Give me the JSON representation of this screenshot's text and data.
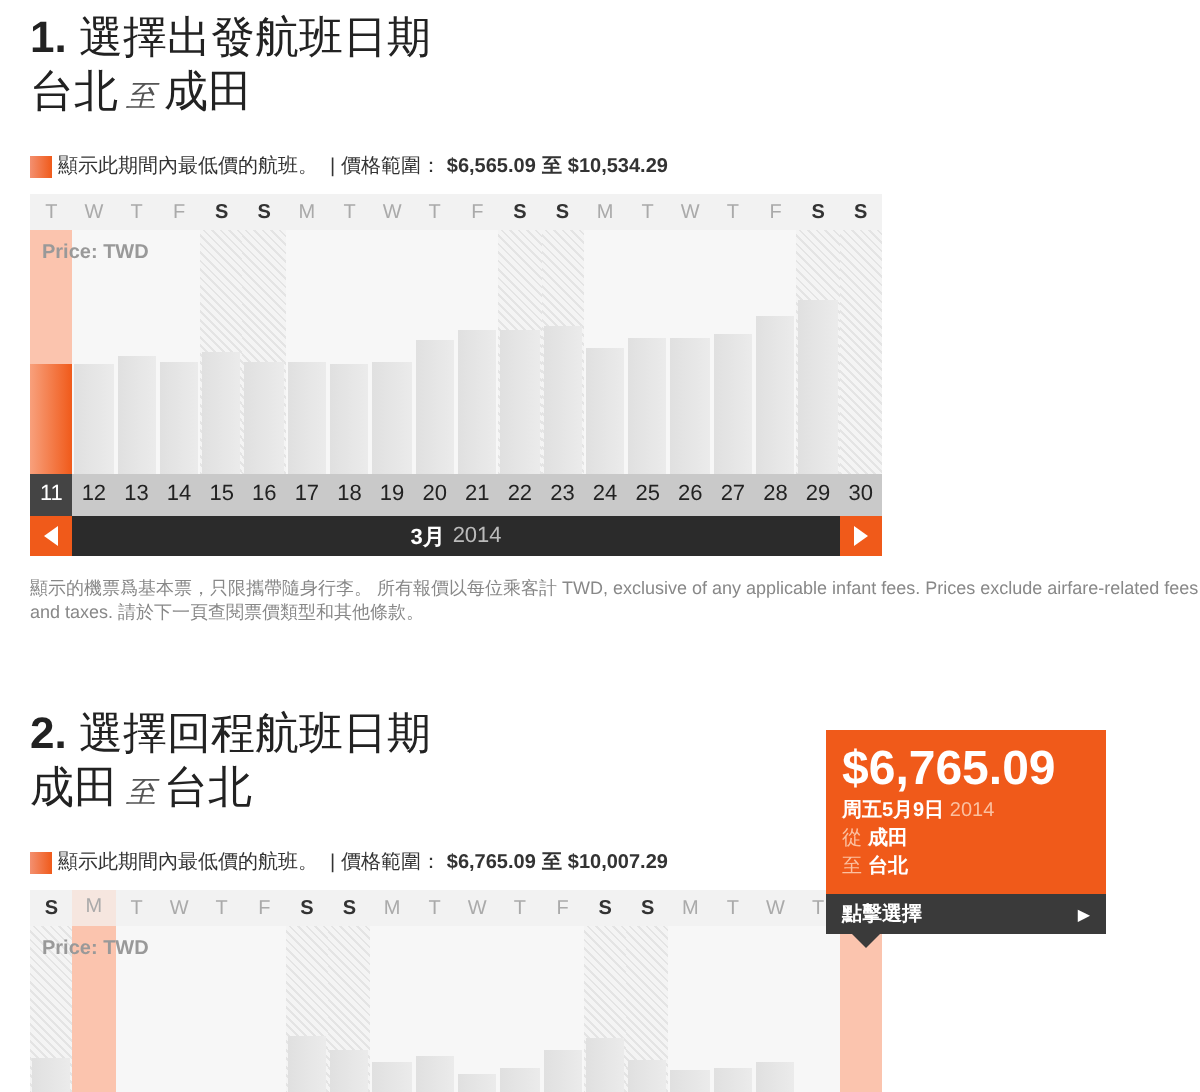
{
  "outbound": {
    "step": "1.",
    "title": "選擇出發航班日期",
    "origin": "台北",
    "connector": "至",
    "destination": "成田",
    "legend": "顯示此期間內最低價的航班。",
    "range_label": "| 價格範圍：",
    "range_low": "$6,565.09",
    "range_to": "至",
    "range_high": "$10,534.29",
    "price_label": "Price: TWD",
    "days": [
      {
        "weekday": "T",
        "date": "11",
        "weekend": false,
        "selected": true
      },
      {
        "weekday": "W",
        "date": "12",
        "weekend": false,
        "selected": false
      },
      {
        "weekday": "T",
        "date": "13",
        "weekend": false,
        "selected": false
      },
      {
        "weekday": "F",
        "date": "14",
        "weekend": false,
        "selected": false
      },
      {
        "weekday": "S",
        "date": "15",
        "weekend": true,
        "selected": false
      },
      {
        "weekday": "S",
        "date": "16",
        "weekend": true,
        "selected": false
      },
      {
        "weekday": "M",
        "date": "17",
        "weekend": false,
        "selected": false
      },
      {
        "weekday": "T",
        "date": "18",
        "weekend": false,
        "selected": false
      },
      {
        "weekday": "W",
        "date": "19",
        "weekend": false,
        "selected": false
      },
      {
        "weekday": "T",
        "date": "20",
        "weekend": false,
        "selected": false
      },
      {
        "weekday": "F",
        "date": "21",
        "weekend": false,
        "selected": false
      },
      {
        "weekday": "S",
        "date": "22",
        "weekend": true,
        "selected": false
      },
      {
        "weekday": "S",
        "date": "23",
        "weekend": true,
        "selected": false
      },
      {
        "weekday": "M",
        "date": "24",
        "weekend": false,
        "selected": false
      },
      {
        "weekday": "T",
        "date": "25",
        "weekend": false,
        "selected": false
      },
      {
        "weekday": "W",
        "date": "26",
        "weekend": false,
        "selected": false
      },
      {
        "weekday": "T",
        "date": "27",
        "weekend": false,
        "selected": false
      },
      {
        "weekday": "F",
        "date": "28",
        "weekend": false,
        "selected": false
      },
      {
        "weekday": "S",
        "date": "29",
        "weekend": true,
        "selected": false
      },
      {
        "weekday": "S",
        "date": "30",
        "weekend": true,
        "selected": false
      }
    ],
    "month": "3月",
    "year": "2014",
    "note": "顯示的機票爲基本票，只限攜帶隨身行李。 所有報價以每位乘客計 TWD, exclusive of any applicable infant fees. Prices exclude airfare-related fees and taxes. 請於下一頁查閱票價類型和其他條款。"
  },
  "return": {
    "step": "2.",
    "title": "選擇回程航班日期",
    "origin": "成田",
    "connector": "至",
    "destination": "台北",
    "legend": "顯示此期間內最低價的航班。",
    "range_label": "| 價格範圍：",
    "range_low": "$6,765.09",
    "range_to": "至",
    "range_high": "$10,007.29",
    "price_label": "Price: TWD",
    "days": [
      {
        "weekday": "S",
        "weekend": true,
        "selected": false
      },
      {
        "weekday": "M",
        "weekend": false,
        "selected": true
      },
      {
        "weekday": "T",
        "weekend": false,
        "selected": false
      },
      {
        "weekday": "W",
        "weekend": false,
        "selected": false
      },
      {
        "weekday": "T",
        "weekend": false,
        "selected": false
      },
      {
        "weekday": "F",
        "weekend": false,
        "selected": false
      },
      {
        "weekday": "S",
        "weekend": true,
        "selected": false
      },
      {
        "weekday": "S",
        "weekend": true,
        "selected": false
      },
      {
        "weekday": "M",
        "weekend": false,
        "selected": false
      },
      {
        "weekday": "T",
        "weekend": false,
        "selected": false
      },
      {
        "weekday": "W",
        "weekend": false,
        "selected": false
      },
      {
        "weekday": "T",
        "weekend": false,
        "selected": false
      },
      {
        "weekday": "F",
        "weekend": false,
        "selected": false
      },
      {
        "weekday": "S",
        "weekend": true,
        "selected": false
      },
      {
        "weekday": "S",
        "weekend": true,
        "selected": false
      },
      {
        "weekday": "M",
        "weekend": false,
        "selected": false
      },
      {
        "weekday": "T",
        "weekend": false,
        "selected": false
      },
      {
        "weekday": "W",
        "weekend": false,
        "selected": false
      },
      {
        "weekday": "T",
        "weekend": false,
        "selected": false
      },
      {
        "weekend": false,
        "selected": true
      }
    ],
    "tooltip": {
      "price": "$6,765.09",
      "date": "周五5月9日",
      "year": "2014",
      "from_label": "從",
      "from": "成田",
      "to_label": "至",
      "to": "台北",
      "action": "點擊選擇",
      "action_icon": "▶"
    }
  }
}
